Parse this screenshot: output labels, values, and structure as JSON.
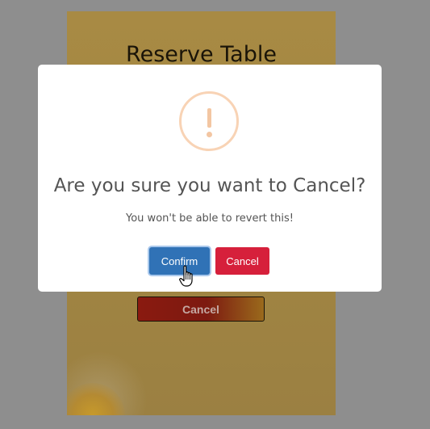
{
  "background": {
    "title": "Reserve Table",
    "cancel_label": "Cancel"
  },
  "dialog": {
    "icon": "exclamation-icon",
    "title": "Are you sure you want to Cancel?",
    "text": "You won't be able to revert this!",
    "confirm_label": "Confirm",
    "cancel_label": "Cancel"
  },
  "colors": {
    "confirm_button": "#3072b6",
    "cancel_button": "#d6203b",
    "warning_icon": "#f8d3b5",
    "overlay": "#8e8e8e"
  }
}
